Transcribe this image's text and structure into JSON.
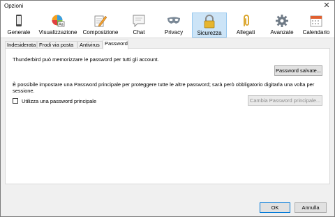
{
  "window": {
    "title": "Opzioni",
    "close": "✕"
  },
  "toolbar": {
    "items": [
      {
        "label": "Generale",
        "icon": "general-phone-icon"
      },
      {
        "label": "Visualizzazione",
        "icon": "display-palette-icon"
      },
      {
        "label": "Composizione",
        "icon": "compose-pencil-icon"
      },
      {
        "label": "Chat",
        "icon": "chat-bubble-icon"
      },
      {
        "label": "Privacy",
        "icon": "privacy-mask-icon"
      },
      {
        "label": "Sicurezza",
        "icon": "security-lock-icon"
      },
      {
        "label": "Allegati",
        "icon": "attachment-clip-icon"
      },
      {
        "label": "Avanzate",
        "icon": "advanced-gear-icon"
      },
      {
        "label": "Calendario",
        "icon": "calendar-icon"
      }
    ],
    "selected": "Sicurezza"
  },
  "tabs": [
    "Indesiderata",
    "Frodi via posta",
    "Antivirus",
    "Password"
  ],
  "active_tab": "Password",
  "password": {
    "intro": "Thunderbird può memorizzare le password per tutti gli account.",
    "saved_button": "Password salvate...",
    "master_info_line1": "È possibile impostare una Password principale per proteggere tutte le altre password; sarà però obbligatorio digitarla una volta per",
    "master_info_line2": "sessione.",
    "use_master_label": "Utilizza una password principale",
    "use_master_checked": false,
    "change_master_button": "Cambia Password principale..."
  },
  "footer": {
    "ok": "OK",
    "cancel": "Annulla"
  },
  "colors": {
    "selected_bg": "#cce4f7",
    "selected_border": "#99c9ef",
    "accent_border": "#0078d7"
  }
}
